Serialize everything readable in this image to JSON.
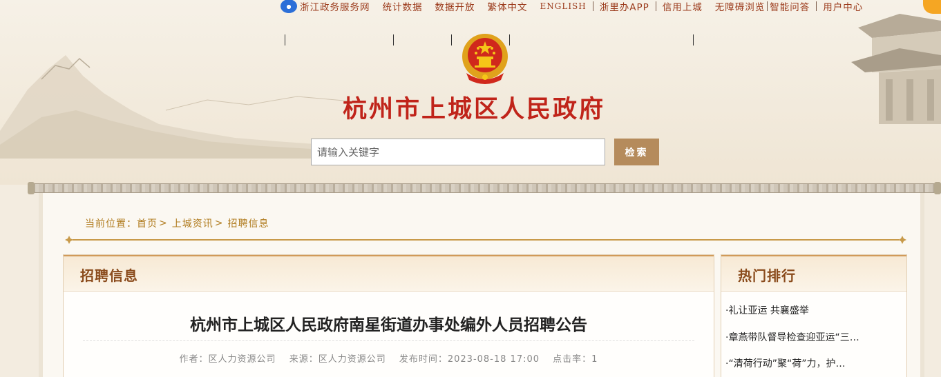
{
  "toplinks": {
    "items": [
      "浙江政务服务网",
      "统计数据",
      "数据开放",
      "繁体中文",
      "ENGLISH",
      "浙里办APP",
      "信用上城",
      "无障碍浏览",
      "智能问答",
      "用户中心"
    ]
  },
  "site": {
    "title": "杭州市上城区人民政府"
  },
  "search": {
    "placeholder": "请输入关键字",
    "button": "检索"
  },
  "breadcrumb": {
    "label": "当前位置：",
    "items": [
      "首页",
      "上城资讯",
      "招聘信息"
    ]
  },
  "main": {
    "section_title": "招聘信息",
    "article": {
      "title": "杭州市上城区人民政府南星街道办事处编外人员招聘公告",
      "author": "作者：区人力资源公司",
      "source": "来源：区人力资源公司",
      "publish_time": "发布时间：2023-08-18 17:00",
      "clicks": "点击率：1"
    }
  },
  "sidebar": {
    "title": "热门排行",
    "items": [
      "·礼让亚运 共襄盛举",
      "·章燕带队督导检查迎亚运“三…",
      "·“清荷行动”聚“荷”力，护…"
    ]
  },
  "colors": {
    "title_red": "#c0241a",
    "link_brown": "#9b3a1b",
    "search_button": "#b58b5c",
    "breadcrumb": "#b07b1e",
    "panel_title": "#8a4b1c"
  }
}
